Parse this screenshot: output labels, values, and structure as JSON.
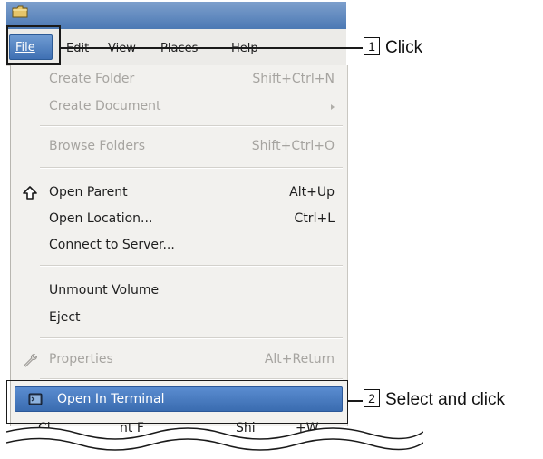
{
  "menubar": {
    "file": "File",
    "edit": "Edit",
    "view": "View",
    "places": "Places",
    "help": "Help"
  },
  "menu": {
    "create_folder": {
      "label": "Create Folder",
      "shortcut": "Shift+Ctrl+N"
    },
    "create_document": {
      "label": "Create Document"
    },
    "browse_folders": {
      "label": "Browse Folders",
      "shortcut": "Shift+Ctrl+O"
    },
    "open_parent": {
      "label": "Open Parent",
      "shortcut": "Alt+Up"
    },
    "open_location": {
      "label": "Open Location...",
      "shortcut": "Ctrl+L"
    },
    "connect_server": {
      "label": "Connect to Server..."
    },
    "unmount_volume": {
      "label": "Unmount Volume"
    },
    "eject": {
      "label": "Eject"
    },
    "properties": {
      "label": "Properties",
      "shortcut": "Alt+Return"
    },
    "open_terminal": {
      "label": "Open In Terminal"
    },
    "close_partial": {
      "label": "Cl",
      "label2": "nt F",
      "shortcut": "Shi",
      "shortcut2": "+W"
    }
  },
  "callouts": [
    {
      "num": "1",
      "text": "Click"
    },
    {
      "num": "2",
      "text": "Select and click"
    }
  ],
  "colors": {
    "highlight": "#3f70b3",
    "titlebar": "#4c79b4",
    "menu_bg": "#f2f1ee",
    "disabled_text": "#a6a4a0"
  }
}
